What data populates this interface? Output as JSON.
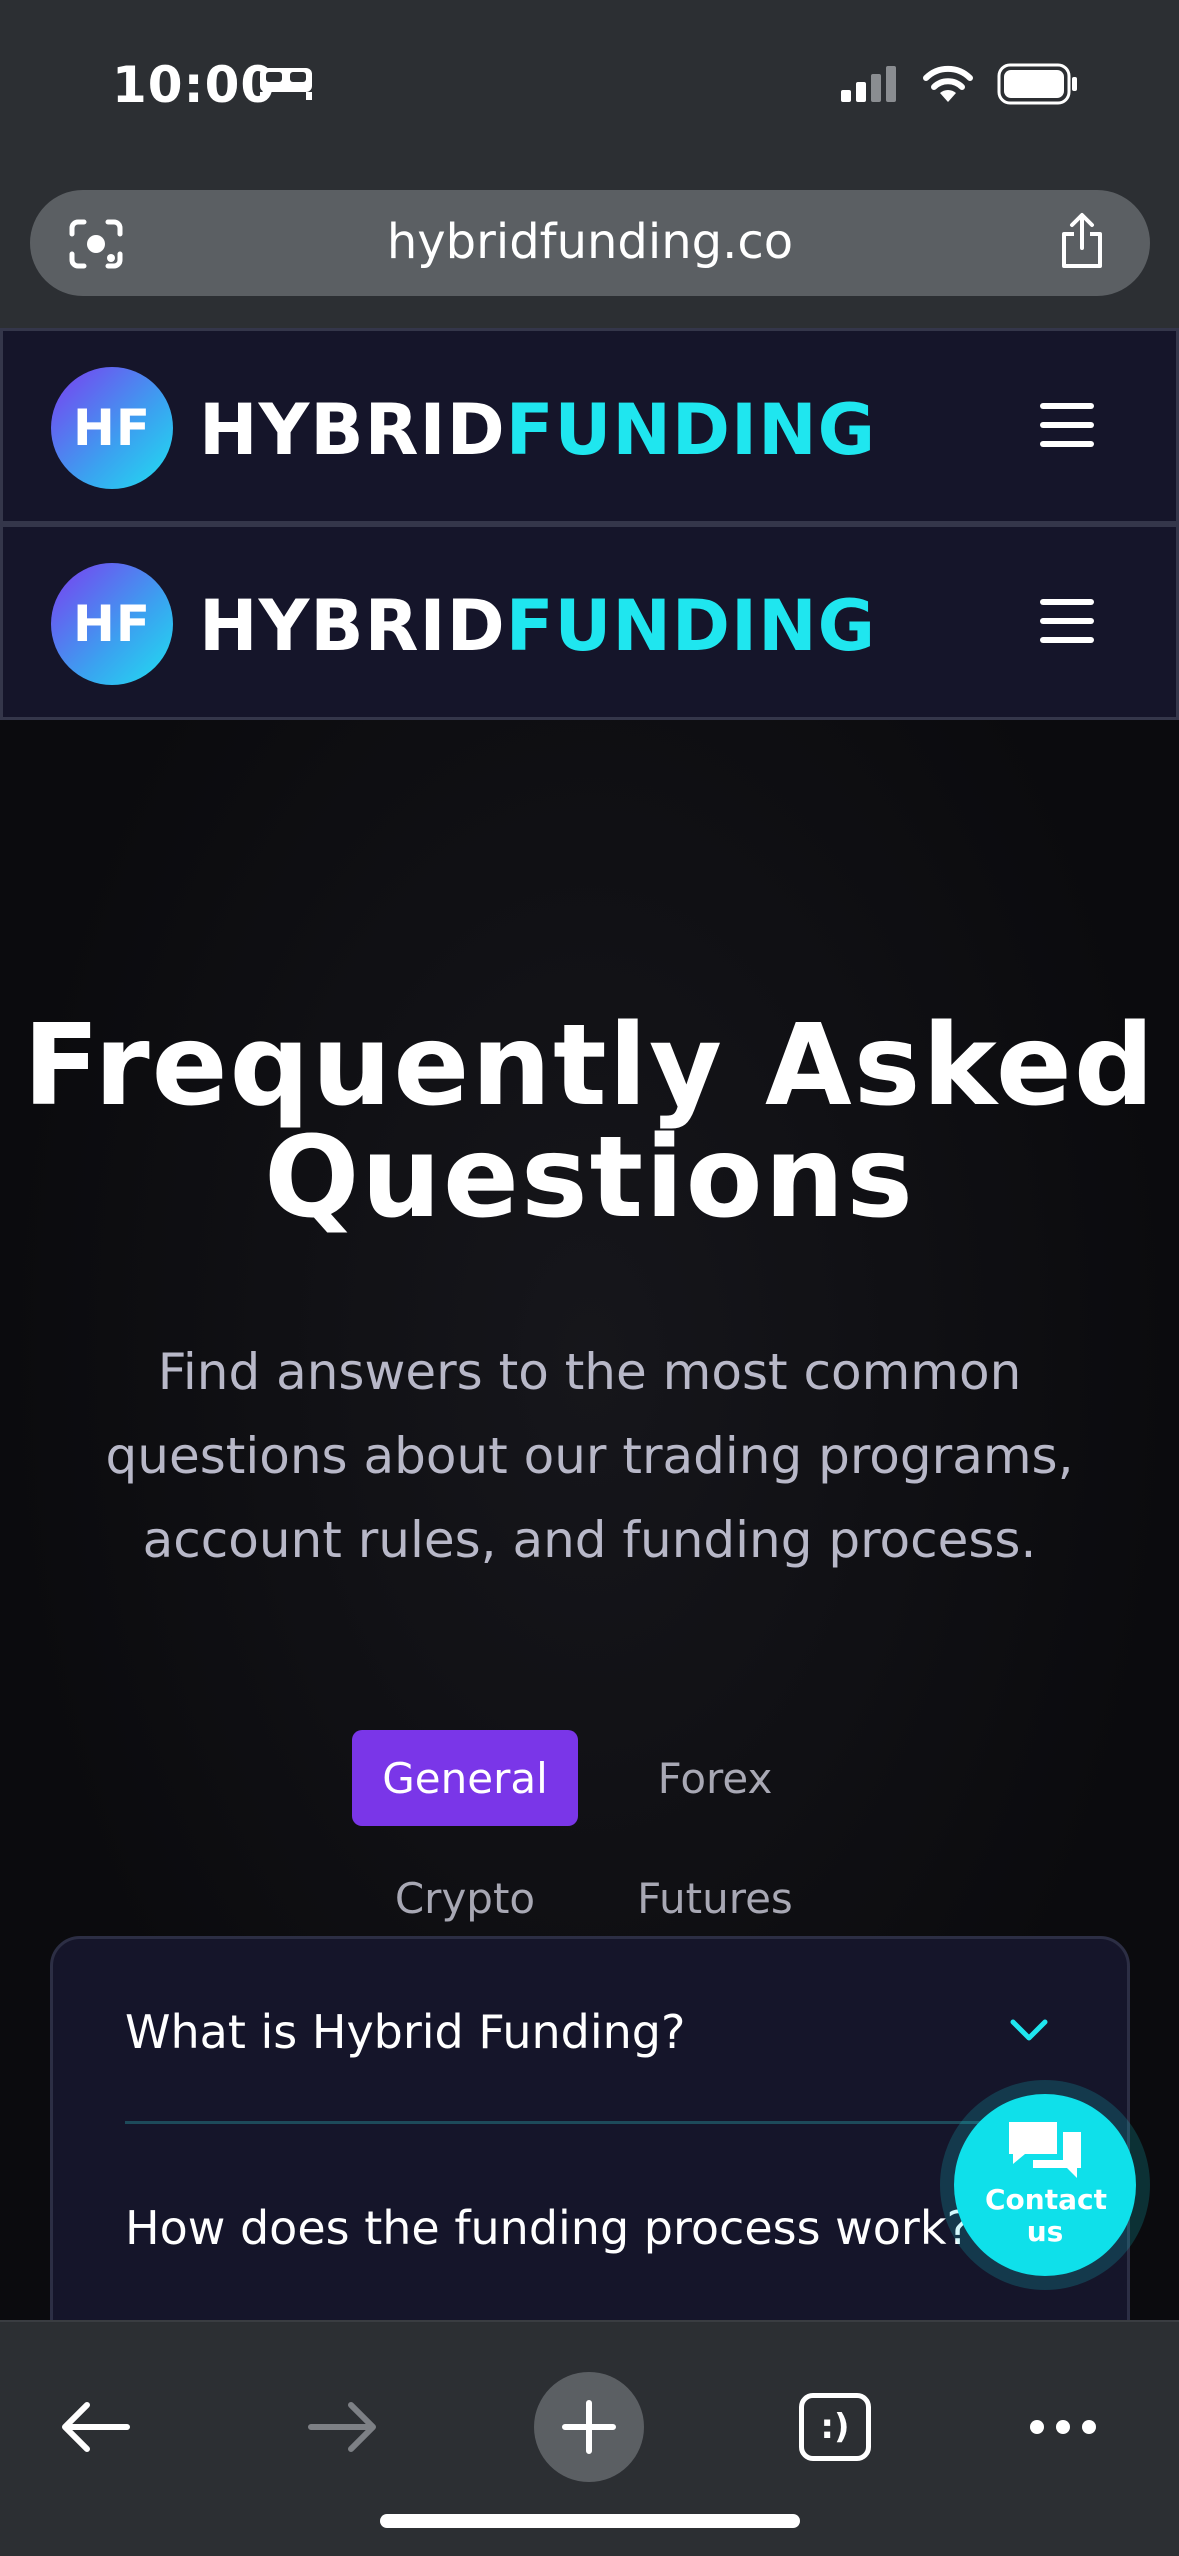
{
  "status_bar": {
    "time": "10:00"
  },
  "browser": {
    "url": "hybridfunding.co"
  },
  "site": {
    "logo_badge": "HF",
    "logo_word_part1": "HYBRID",
    "logo_word_part2": "FUNDING"
  },
  "hero": {
    "title": "Frequently Asked Questions",
    "subtitle": "Find answers to the most common questions about our trading programs, account rules, and funding process."
  },
  "tabs": [
    {
      "label": "General",
      "active": true
    },
    {
      "label": "Forex",
      "active": false
    },
    {
      "label": "Crypto",
      "active": false
    },
    {
      "label": "Futures",
      "active": false
    }
  ],
  "faq": [
    {
      "question": "What is Hybrid Funding?"
    },
    {
      "question": "How does the funding process work?"
    }
  ],
  "contact": {
    "label": "Contact us"
  },
  "toolbar": {
    "tabs_glyph": ":)"
  },
  "colors": {
    "accent_purple": "#7a36e8",
    "accent_cyan": "#1fe6ef",
    "header_bg": "#15152a"
  }
}
